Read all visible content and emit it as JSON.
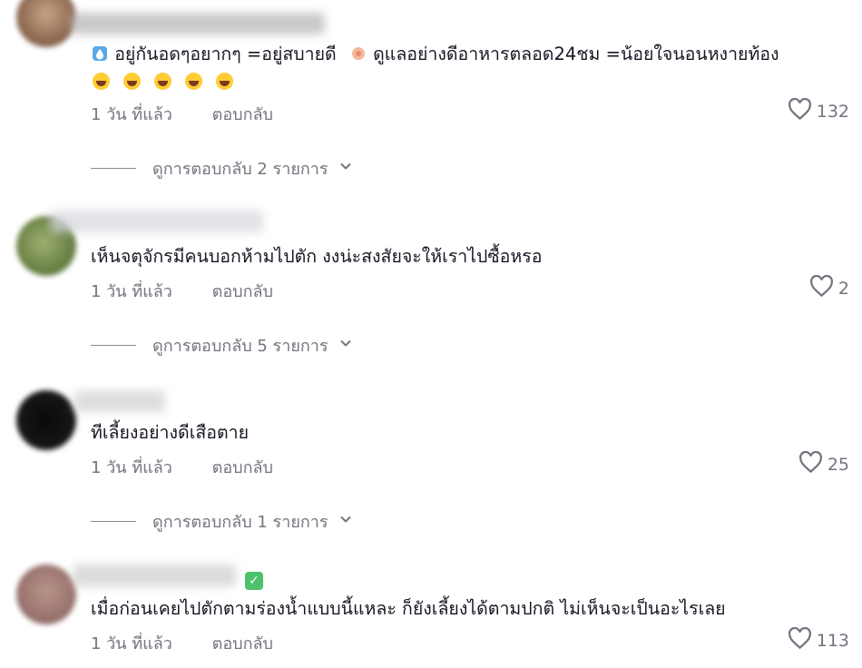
{
  "comments": [
    {
      "text_parts": [
        "อยู่กันอดๆอยากๆ =อยู่สบายดี",
        "ดูแลอย่างดีอาหารตลอด24ชม =น้อยใจนอนหงายท้อง"
      ],
      "time": "1 วัน ที่แล้ว",
      "reply_label": "ตอบกลับ",
      "likes": "132",
      "view_replies": "ดูการตอบกลับ 2 รายการ",
      "emoji_count": 5,
      "emoji": "laughing-crying-emoji"
    },
    {
      "text": "เห็นจตุจักรมีคนบอกห้ามไปตัก งงน่ะสงสัยจะให้เราไปซื้อหรอ",
      "time": "1 วัน ที่แล้ว",
      "reply_label": "ตอบกลับ",
      "likes": "2",
      "view_replies": "ดูการตอบกลับ 5 รายการ"
    },
    {
      "text": "ทีเลี้ยงอย่างดีเสือตาย",
      "time": "1 วัน ที่แล้ว",
      "reply_label": "ตอบกลับ",
      "likes": "25",
      "view_replies": "ดูการตอบกลับ 1 รายการ"
    },
    {
      "text": "เมื่อก่อนเคยไปตักตามร่องน้ำแบบนี้แหละ ก็ยังเลี้ยงได้ตามปกติ ไม่เห็นจะเป็นอะไรเลย",
      "time": "1 วัน ที่แล้ว",
      "reply_label": "ตอบกลับ",
      "likes": "113",
      "verified_icon": "check-box-icon"
    }
  ],
  "colors": {
    "text": "#161823",
    "muted": "#737480",
    "verified": "#4cc26a"
  }
}
